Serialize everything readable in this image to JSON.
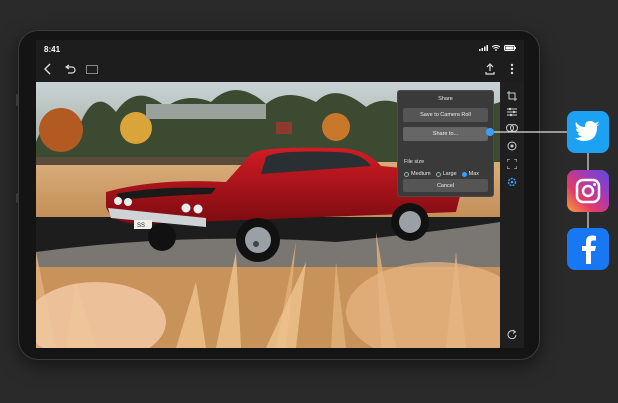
{
  "status": {
    "time": "8:41"
  },
  "share_panel": {
    "title": "Share",
    "save_label": "Save to Camera Roll",
    "share_label": "Share to...",
    "file_size_label": "File size",
    "options": [
      "Medium",
      "Large",
      "Max"
    ],
    "selected": "Max",
    "cancel_label": "Cancel"
  },
  "photo": {
    "license_plate": "SS"
  },
  "social": [
    "twitter-icon",
    "instagram-icon",
    "facebook-icon"
  ],
  "colors": {
    "accent": "#3aa0ff",
    "twitter": "#1da1f2",
    "facebook": "#1877f2",
    "car": "#b3121a"
  }
}
